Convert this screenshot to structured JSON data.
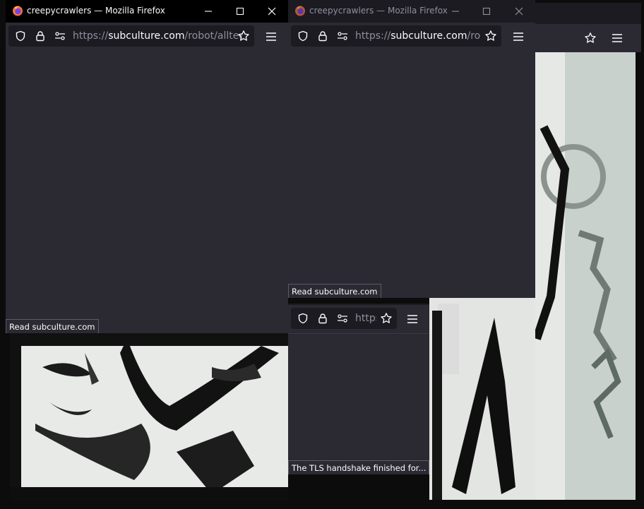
{
  "desktop": {
    "description_colors": {
      "frame": "#0c0c0c",
      "paper": "#e6e9e6",
      "ink": "#101010"
    }
  },
  "windows": {
    "main": {
      "title": "creepycrawlers — Mozilla Firefox",
      "url_prefix": "https://",
      "url_host": "subculture.com",
      "url_path": "/robot/allteens",
      "status": "Read subculture.com"
    },
    "second": {
      "title": "creepycrawlers — Mozilla Firefox",
      "url_prefix": "https://",
      "url_host": "subculture.com",
      "url_path": "/robot/",
      "status": "Read subculture.com"
    },
    "third": {
      "url_prefix": "https:",
      "status": "The TLS handshake finished for..."
    }
  },
  "icons": [
    "firefox-logo-icon",
    "minimize-icon",
    "maximize-icon",
    "close-icon",
    "shield-icon",
    "lock-icon",
    "permissions-icon",
    "bookmark-star-icon",
    "hamburger-menu-icon"
  ],
  "colors": {
    "toolbar": "#2b2a33",
    "urlfield": "#1c1b22",
    "text": "#fbfbfe",
    "dim": "#8f8f9d",
    "titlebar_active": "#000000"
  }
}
